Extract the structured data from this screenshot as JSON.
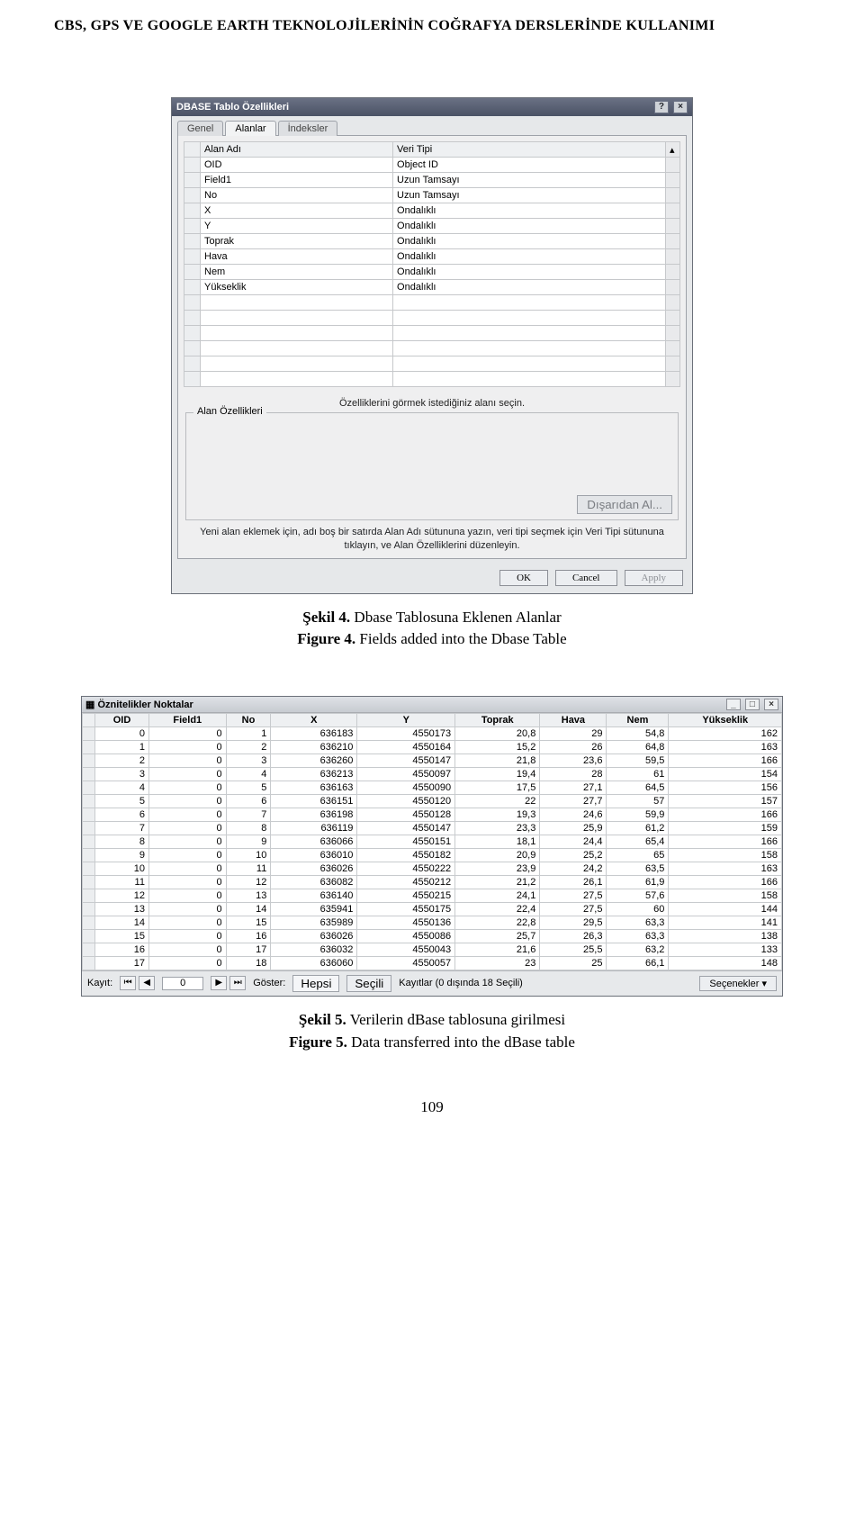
{
  "page_header": "CBS, GPS VE GOOGLE EARTH TEKNOLOJİLERİNİN COĞRAFYA DERSLERİNDE KULLANIMI",
  "page_number": "109",
  "figure4": {
    "cap1_bold": "Şekil 4.",
    "cap1_rest": " Dbase Tablosuna Eklenen Alanlar",
    "cap2_bold": "Figure 4.",
    "cap2_rest": " Fields added into the Dbase Table",
    "dialog_title": "DBASE Tablo Özellikleri",
    "tabs": {
      "t0": "Genel",
      "t1": "Alanlar",
      "t2": "İndeksler"
    },
    "grid_headers": {
      "h1": "Alan Adı",
      "h2": "Veri Tipi"
    },
    "rows": [
      {
        "name": "OID",
        "type": "Object ID"
      },
      {
        "name": "Field1",
        "type": "Uzun Tamsayı"
      },
      {
        "name": "No",
        "type": "Uzun Tamsayı"
      },
      {
        "name": "X",
        "type": "Ondalıklı"
      },
      {
        "name": "Y",
        "type": "Ondalıklı"
      },
      {
        "name": "Toprak",
        "type": "Ondalıklı"
      },
      {
        "name": "Hava",
        "type": "Ondalıklı"
      },
      {
        "name": "Nem",
        "type": "Ondalıklı"
      },
      {
        "name": "Yükseklik",
        "type": "Ondalıklı"
      }
    ],
    "hint": "Özelliklerini görmek istediğiniz alanı seçin.",
    "fieldset_label": "Alan Özellikleri",
    "import_btn": "Dışarıdan Al...",
    "help_text": "Yeni alan eklemek için, adı boş bir satırda Alan Adı sütununa yazın, veri tipi seçmek için Veri Tipi sütununa tıklayın, ve Alan Özelliklerini düzenleyin.",
    "btn_ok": "OK",
    "btn_cancel": "Cancel",
    "btn_apply": "Apply"
  },
  "figure5": {
    "cap1_bold": "Şekil 5.",
    "cap1_rest": " Verilerin dBase tablosuna girilmesi",
    "cap2_bold": "Figure 5.",
    "cap2_rest": " Data transferred into the dBase table",
    "window_title": "Öznitelikler Noktalar",
    "headers": [
      "OID",
      "Field1",
      "No",
      "X",
      "Y",
      "Toprak",
      "Hava",
      "Nem",
      "Yükseklik"
    ],
    "rows": [
      [
        "0",
        "0",
        "1",
        "636183",
        "4550173",
        "20,8",
        "29",
        "54,8",
        "162"
      ],
      [
        "1",
        "0",
        "2",
        "636210",
        "4550164",
        "15,2",
        "26",
        "64,8",
        "163"
      ],
      [
        "2",
        "0",
        "3",
        "636260",
        "4550147",
        "21,8",
        "23,6",
        "59,5",
        "166"
      ],
      [
        "3",
        "0",
        "4",
        "636213",
        "4550097",
        "19,4",
        "28",
        "61",
        "154"
      ],
      [
        "4",
        "0",
        "5",
        "636163",
        "4550090",
        "17,5",
        "27,1",
        "64,5",
        "156"
      ],
      [
        "5",
        "0",
        "6",
        "636151",
        "4550120",
        "22",
        "27,7",
        "57",
        "157"
      ],
      [
        "6",
        "0",
        "7",
        "636198",
        "4550128",
        "19,3",
        "24,6",
        "59,9",
        "166"
      ],
      [
        "7",
        "0",
        "8",
        "636119",
        "4550147",
        "23,3",
        "25,9",
        "61,2",
        "159"
      ],
      [
        "8",
        "0",
        "9",
        "636066",
        "4550151",
        "18,1",
        "24,4",
        "65,4",
        "166"
      ],
      [
        "9",
        "0",
        "10",
        "636010",
        "4550182",
        "20,9",
        "25,2",
        "65",
        "158"
      ],
      [
        "10",
        "0",
        "11",
        "636026",
        "4550222",
        "23,9",
        "24,2",
        "63,5",
        "163"
      ],
      [
        "11",
        "0",
        "12",
        "636082",
        "4550212",
        "21,2",
        "26,1",
        "61,9",
        "166"
      ],
      [
        "12",
        "0",
        "13",
        "636140",
        "4550215",
        "24,1",
        "27,5",
        "57,6",
        "158"
      ],
      [
        "13",
        "0",
        "14",
        "635941",
        "4550175",
        "22,4",
        "27,5",
        "60",
        "144"
      ],
      [
        "14",
        "0",
        "15",
        "635989",
        "4550136",
        "22,8",
        "29,5",
        "63,3",
        "141"
      ],
      [
        "15",
        "0",
        "16",
        "636026",
        "4550086",
        "25,7",
        "26,3",
        "63,3",
        "138"
      ],
      [
        "16",
        "0",
        "17",
        "636032",
        "4550043",
        "21,6",
        "25,5",
        "63,2",
        "133"
      ],
      [
        "17",
        "0",
        "18",
        "636060",
        "4550057",
        "23",
        "25",
        "66,1",
        "148"
      ]
    ],
    "footer": {
      "label_kayit": "Kayıt:",
      "record_value": "0",
      "label_goster": "Göster:",
      "btn_hepsi": "Hepsi",
      "btn_secili": "Seçili",
      "count_text": "Kayıtlar (0 dışında 18 Seçili)",
      "options": "Seçenekler ▾"
    }
  }
}
